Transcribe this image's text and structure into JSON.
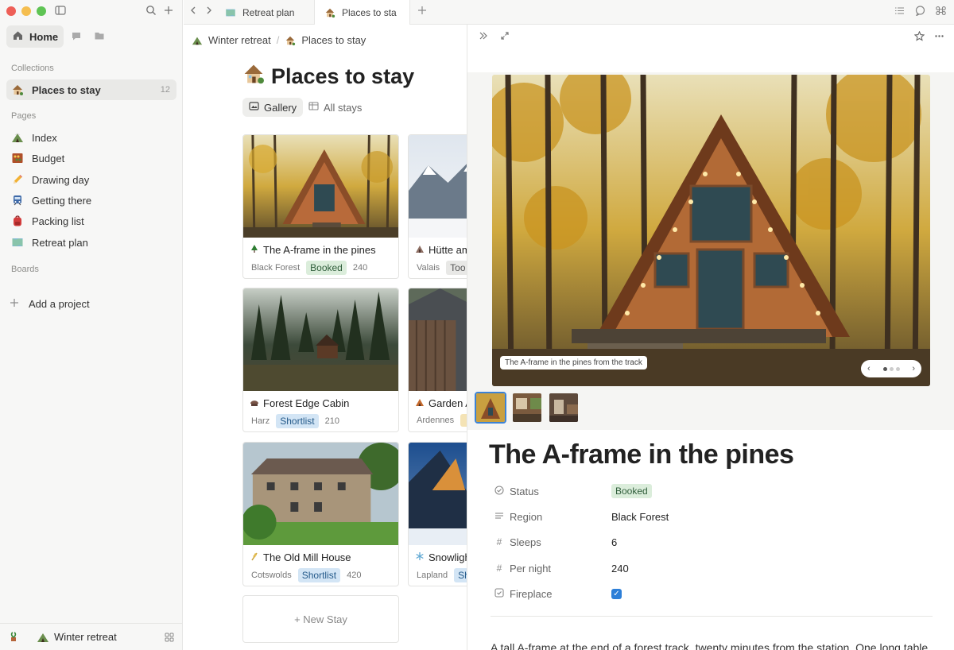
{
  "tabs": [
    {
      "label": "Retreat plan",
      "icon": "map-icon"
    },
    {
      "label": "Places to sta",
      "icon": "house-icon"
    }
  ],
  "sidebar": {
    "home_label": "Home",
    "collections_heading": "Collections",
    "collection_item": {
      "label": "Places to stay",
      "count": "12",
      "icon": "house-icon"
    },
    "pages_heading": "Pages",
    "pages": [
      {
        "label": "Index",
        "icon": "tent-icon"
      },
      {
        "label": "Budget",
        "icon": "abacus-icon"
      },
      {
        "label": "Drawing day",
        "icon": "pencil-icon"
      },
      {
        "label": "Getting there",
        "icon": "train-icon"
      },
      {
        "label": "Packing list",
        "icon": "backpack-icon"
      },
      {
        "label": "Retreat plan",
        "icon": "map-icon"
      }
    ],
    "boards_heading": "Boards",
    "add_project_label": "Add a project",
    "footer_label": "Winter retreat"
  },
  "main": {
    "breadcrumb": [
      "Winter retreat",
      "Places to stay"
    ],
    "title": "Places to stay",
    "views": [
      {
        "label": "Gallery",
        "icon": "gallery-icon"
      },
      {
        "label": "All stays",
        "icon": "table-icon"
      }
    ],
    "cards": [
      {
        "title": "The A-frame in the pines",
        "region": "Black Forest",
        "status": "Booked",
        "status_type": "booked",
        "price": "240"
      },
      {
        "title": "Hütte am",
        "region": "Valais",
        "status": "Too",
        "status_type": "gray",
        "price": ""
      },
      {
        "title": "Forest Edge Cabin",
        "region": "Harz",
        "status": "Shortlist",
        "status_type": "shortlist",
        "price": "210"
      },
      {
        "title": "Garden A",
        "region": "Ardennes",
        "status": "",
        "status_type": "yellow",
        "price": ""
      },
      {
        "title": "The Old Mill House",
        "region": "Cotswolds",
        "status": "Shortlist",
        "status_type": "shortlist",
        "price": "420"
      },
      {
        "title": "Snowligh",
        "region": "Lapland",
        "status": "Sh",
        "status_type": "shortlist",
        "price": ""
      }
    ],
    "new_stay_label": "+ New Stay"
  },
  "detail": {
    "caption": "The A-frame in the pines from the track",
    "title": "The A-frame in the pines",
    "properties": [
      {
        "label": "Status",
        "value": "Booked",
        "icon": "status-icon"
      },
      {
        "label": "Region",
        "value": "Black Forest",
        "icon": "text-icon"
      },
      {
        "label": "Sleeps",
        "value": "6",
        "icon": "hash-icon"
      },
      {
        "label": "Per night",
        "value": "240",
        "icon": "hash-icon"
      },
      {
        "label": "Fireplace",
        "value": "checked",
        "icon": "checkbox-icon"
      }
    ],
    "body_text": "A tall A-frame at the end of a forest track, twenty minutes from the station. One long table"
  },
  "colors": {
    "booked_bg": "#dbeddb",
    "shortlist_bg": "#d3e5f5",
    "accent_blue": "#2d7fd8"
  }
}
